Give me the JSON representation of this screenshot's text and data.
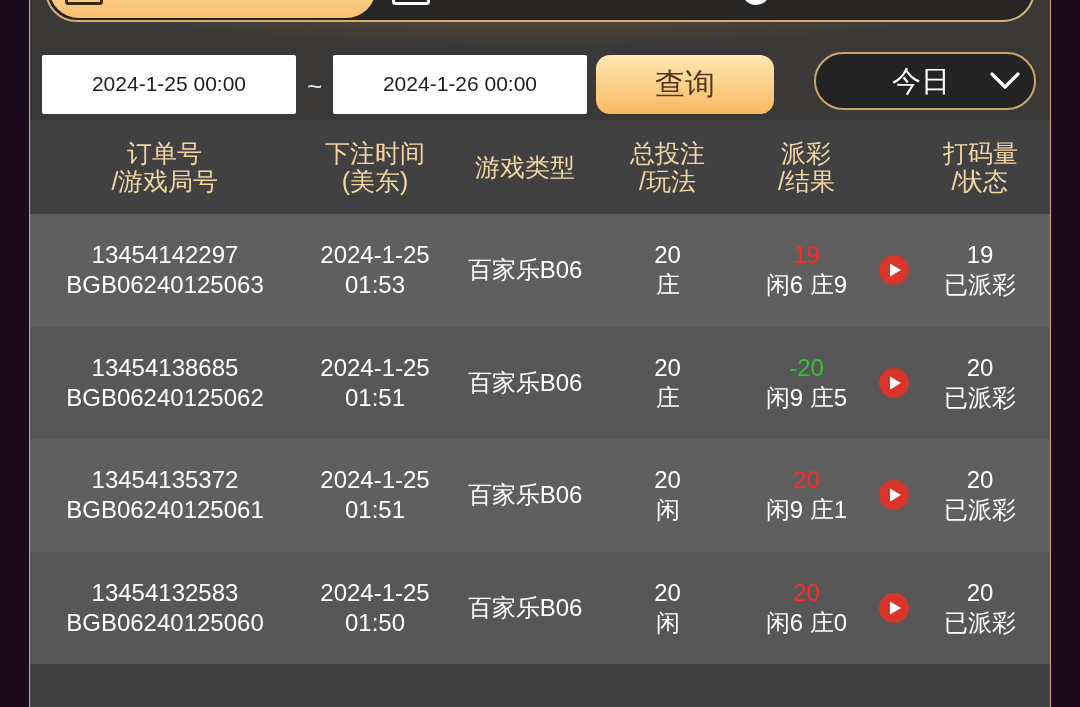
{
  "tabs": [
    {
      "selected": true
    },
    {
      "selected": false
    },
    {
      "selected": false
    }
  ],
  "filter": {
    "start_date": "2024-1-25 00:00",
    "separator": "~",
    "end_date": "2024-1-26 00:00",
    "query_button": "查询",
    "period": "今日"
  },
  "table": {
    "columns": [
      "订单号\n/游戏局号",
      "下注时间\n(美东)",
      "游戏类型",
      "总投注\n/玩法",
      "派彩\n/结果",
      "打码量\n/状态"
    ],
    "rows": [
      {
        "order_no": "13454142297",
        "round_no": "BGB06240125063",
        "bet_date": "2024-1-25",
        "bet_time": "01:53",
        "game_type": "百家乐B06",
        "total_bet": "20",
        "bet_on": "庄",
        "payout": {
          "text": "19",
          "color": "#ff2a2a"
        },
        "result": "闲6 庄9",
        "turnover": "19",
        "status": "已派彩"
      },
      {
        "order_no": "13454138685",
        "round_no": "BGB06240125062",
        "bet_date": "2024-1-25",
        "bet_time": "01:51",
        "game_type": "百家乐B06",
        "total_bet": "20",
        "bet_on": "庄",
        "payout": {
          "text": "-20",
          "color": "#35c035"
        },
        "result": "闲9 庄5",
        "turnover": "20",
        "status": "已派彩"
      },
      {
        "order_no": "13454135372",
        "round_no": "BGB06240125061",
        "bet_date": "2024-1-25",
        "bet_time": "01:51",
        "game_type": "百家乐B06",
        "total_bet": "20",
        "bet_on": "闲",
        "payout": {
          "text": "20",
          "color": "#ff2a2a"
        },
        "result": "闲9 庄1",
        "turnover": "20",
        "status": "已派彩"
      },
      {
        "order_no": "13454132583",
        "round_no": "BGB06240125060",
        "bet_date": "2024-1-25",
        "bet_time": "01:50",
        "game_type": "百家乐B06",
        "total_bet": "20",
        "bet_on": "闲",
        "payout": {
          "text": "20",
          "color": "#ff2a2a"
        },
        "result": "闲6 庄0",
        "turnover": "20",
        "status": "已派彩"
      }
    ]
  }
}
